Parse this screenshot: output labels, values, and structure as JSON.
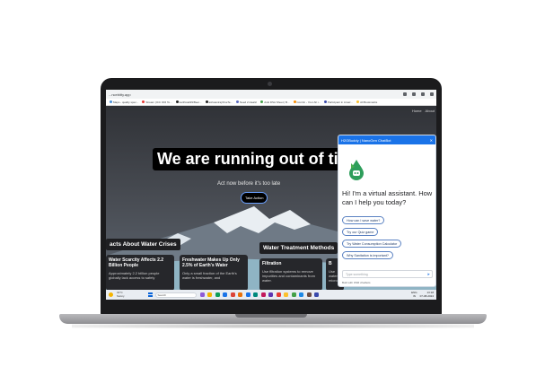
{
  "browser": {
    "url": "...ncebitty.app",
    "bookmarks": [
      {
        "label": "Maps - quality spec...",
        "color": "#4a90d9"
      },
      {
        "label": "Stream (ICC ODI To...",
        "color": "#e53935"
      },
      {
        "label": "karthicak99/Beer...",
        "color": "#222222"
      },
      {
        "label": "ashwaniraj/OneTe...",
        "color": "#222222"
      },
      {
        "label": "Need 2 ideals!",
        "color": "#5c6bc0"
      },
      {
        "label": "Anki DSA Sheet | B...",
        "color": "#43a047"
      },
      {
        "label": "Contrin - Your All i...",
        "color": "#fb8c00"
      },
      {
        "label": "Participant in Amaz...",
        "color": "#3949ab"
      },
      {
        "label": "All Bookmarks",
        "color": "#fbc02d"
      }
    ]
  },
  "page": {
    "nav": [
      "Home",
      "About"
    ],
    "hero_title": "We are running out of tim",
    "hero_subtitle": "Act now before it's too late",
    "cta_label": "Take Action",
    "facts_heading": "acts About Water Crises",
    "methods_heading": "Water Treatment Methods",
    "cards": [
      {
        "title": "Water Scarcity Affects 2.2 Billion People",
        "body": "Approximately 2.2 billion people globally lack access to safely"
      },
      {
        "title": "Freshwater Makes Up Only 2.5% of Earth's Water",
        "body": "Only a small fraction of the Earth's water is freshwater, and"
      },
      {
        "title": "Filtration",
        "body": "Use filtration systems to remove impurities and contaminants from water."
      },
      {
        "title": "B",
        "body": "Use water microorganisms..."
      }
    ]
  },
  "chatbot": {
    "header": "H2OBuddy | NanoGen ChatBot",
    "close_icon": "close-icon",
    "greeting": "Hi! I'm a virtual assistant. How can I help you today?",
    "chips": [
      "How can I save water?",
      "Try our Quiz game",
      "Try Water Consumption Calculator",
      "Why Sanitation is important?"
    ],
    "input_placeholder": "Type something",
    "built_with": "Built with OSR chatbots"
  },
  "taskbar": {
    "weather_temp": "31°C",
    "weather_desc": "Sunny",
    "search_placeholder": "Search",
    "language": "ENG",
    "language_region": "IN",
    "time": "13:18",
    "date": "07-08-2024",
    "app_colors": [
      "#8e5bd8",
      "#f4b400",
      "#0f9d58",
      "#1a73e8",
      "#db4437",
      "#e8710a",
      "#1a73e8",
      "#00897b",
      "#c2185b",
      "#5e35b1",
      "#e53935",
      "#fbc02d",
      "#43a047",
      "#1e88e5",
      "#6d4c41",
      "#3949ab"
    ]
  }
}
